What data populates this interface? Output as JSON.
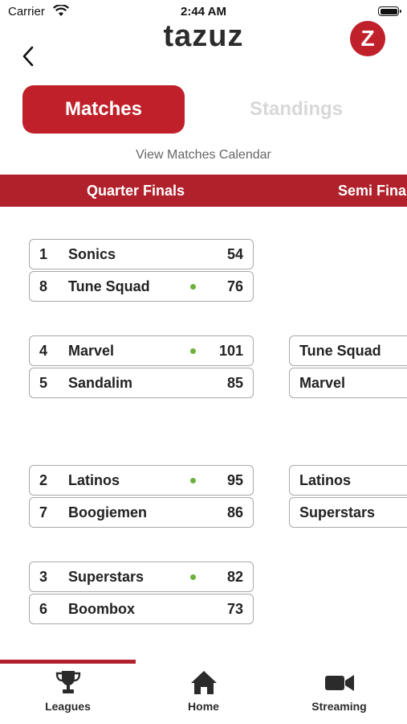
{
  "status_bar": {
    "carrier": "Carrier",
    "time": "2:44 AM"
  },
  "header": {
    "brand": "tazuz",
    "logo_letter": "Z",
    "accent_color": "#c0202a"
  },
  "tabs": [
    {
      "label": "Matches",
      "active": true
    },
    {
      "label": "Standings",
      "active": false
    }
  ],
  "calendar_link": "View Matches Calendar",
  "rounds": [
    "Quarter Finals",
    "Semi Finals"
  ],
  "quarter_finals": [
    {
      "teams": [
        {
          "seed": "1",
          "name": "Sonics",
          "score": "54",
          "winner": false
        },
        {
          "seed": "8",
          "name": "Tune Squad",
          "score": "76",
          "winner": true
        }
      ]
    },
    {
      "teams": [
        {
          "seed": "4",
          "name": "Marvel",
          "score": "101",
          "winner": true
        },
        {
          "seed": "5",
          "name": "Sandalim",
          "score": "85",
          "winner": false
        }
      ]
    },
    {
      "teams": [
        {
          "seed": "2",
          "name": "Latinos",
          "score": "95",
          "winner": true
        },
        {
          "seed": "7",
          "name": "Boogiemen",
          "score": "86",
          "winner": false
        }
      ]
    },
    {
      "teams": [
        {
          "seed": "3",
          "name": "Superstars",
          "score": "82",
          "winner": true
        },
        {
          "seed": "6",
          "name": "Boombox",
          "score": "73",
          "winner": false
        }
      ]
    }
  ],
  "semi_finals": [
    {
      "teams": [
        {
          "name": "Tune Squad"
        },
        {
          "name": "Marvel"
        }
      ]
    },
    {
      "teams": [
        {
          "name": "Latinos"
        },
        {
          "name": "Superstars"
        }
      ]
    }
  ],
  "bottom_nav": [
    {
      "label": "Leagues",
      "icon": "trophy-icon",
      "active": true
    },
    {
      "label": "Home",
      "icon": "home-icon",
      "active": false
    },
    {
      "label": "Streaming",
      "icon": "video-camera-icon",
      "active": false
    }
  ]
}
